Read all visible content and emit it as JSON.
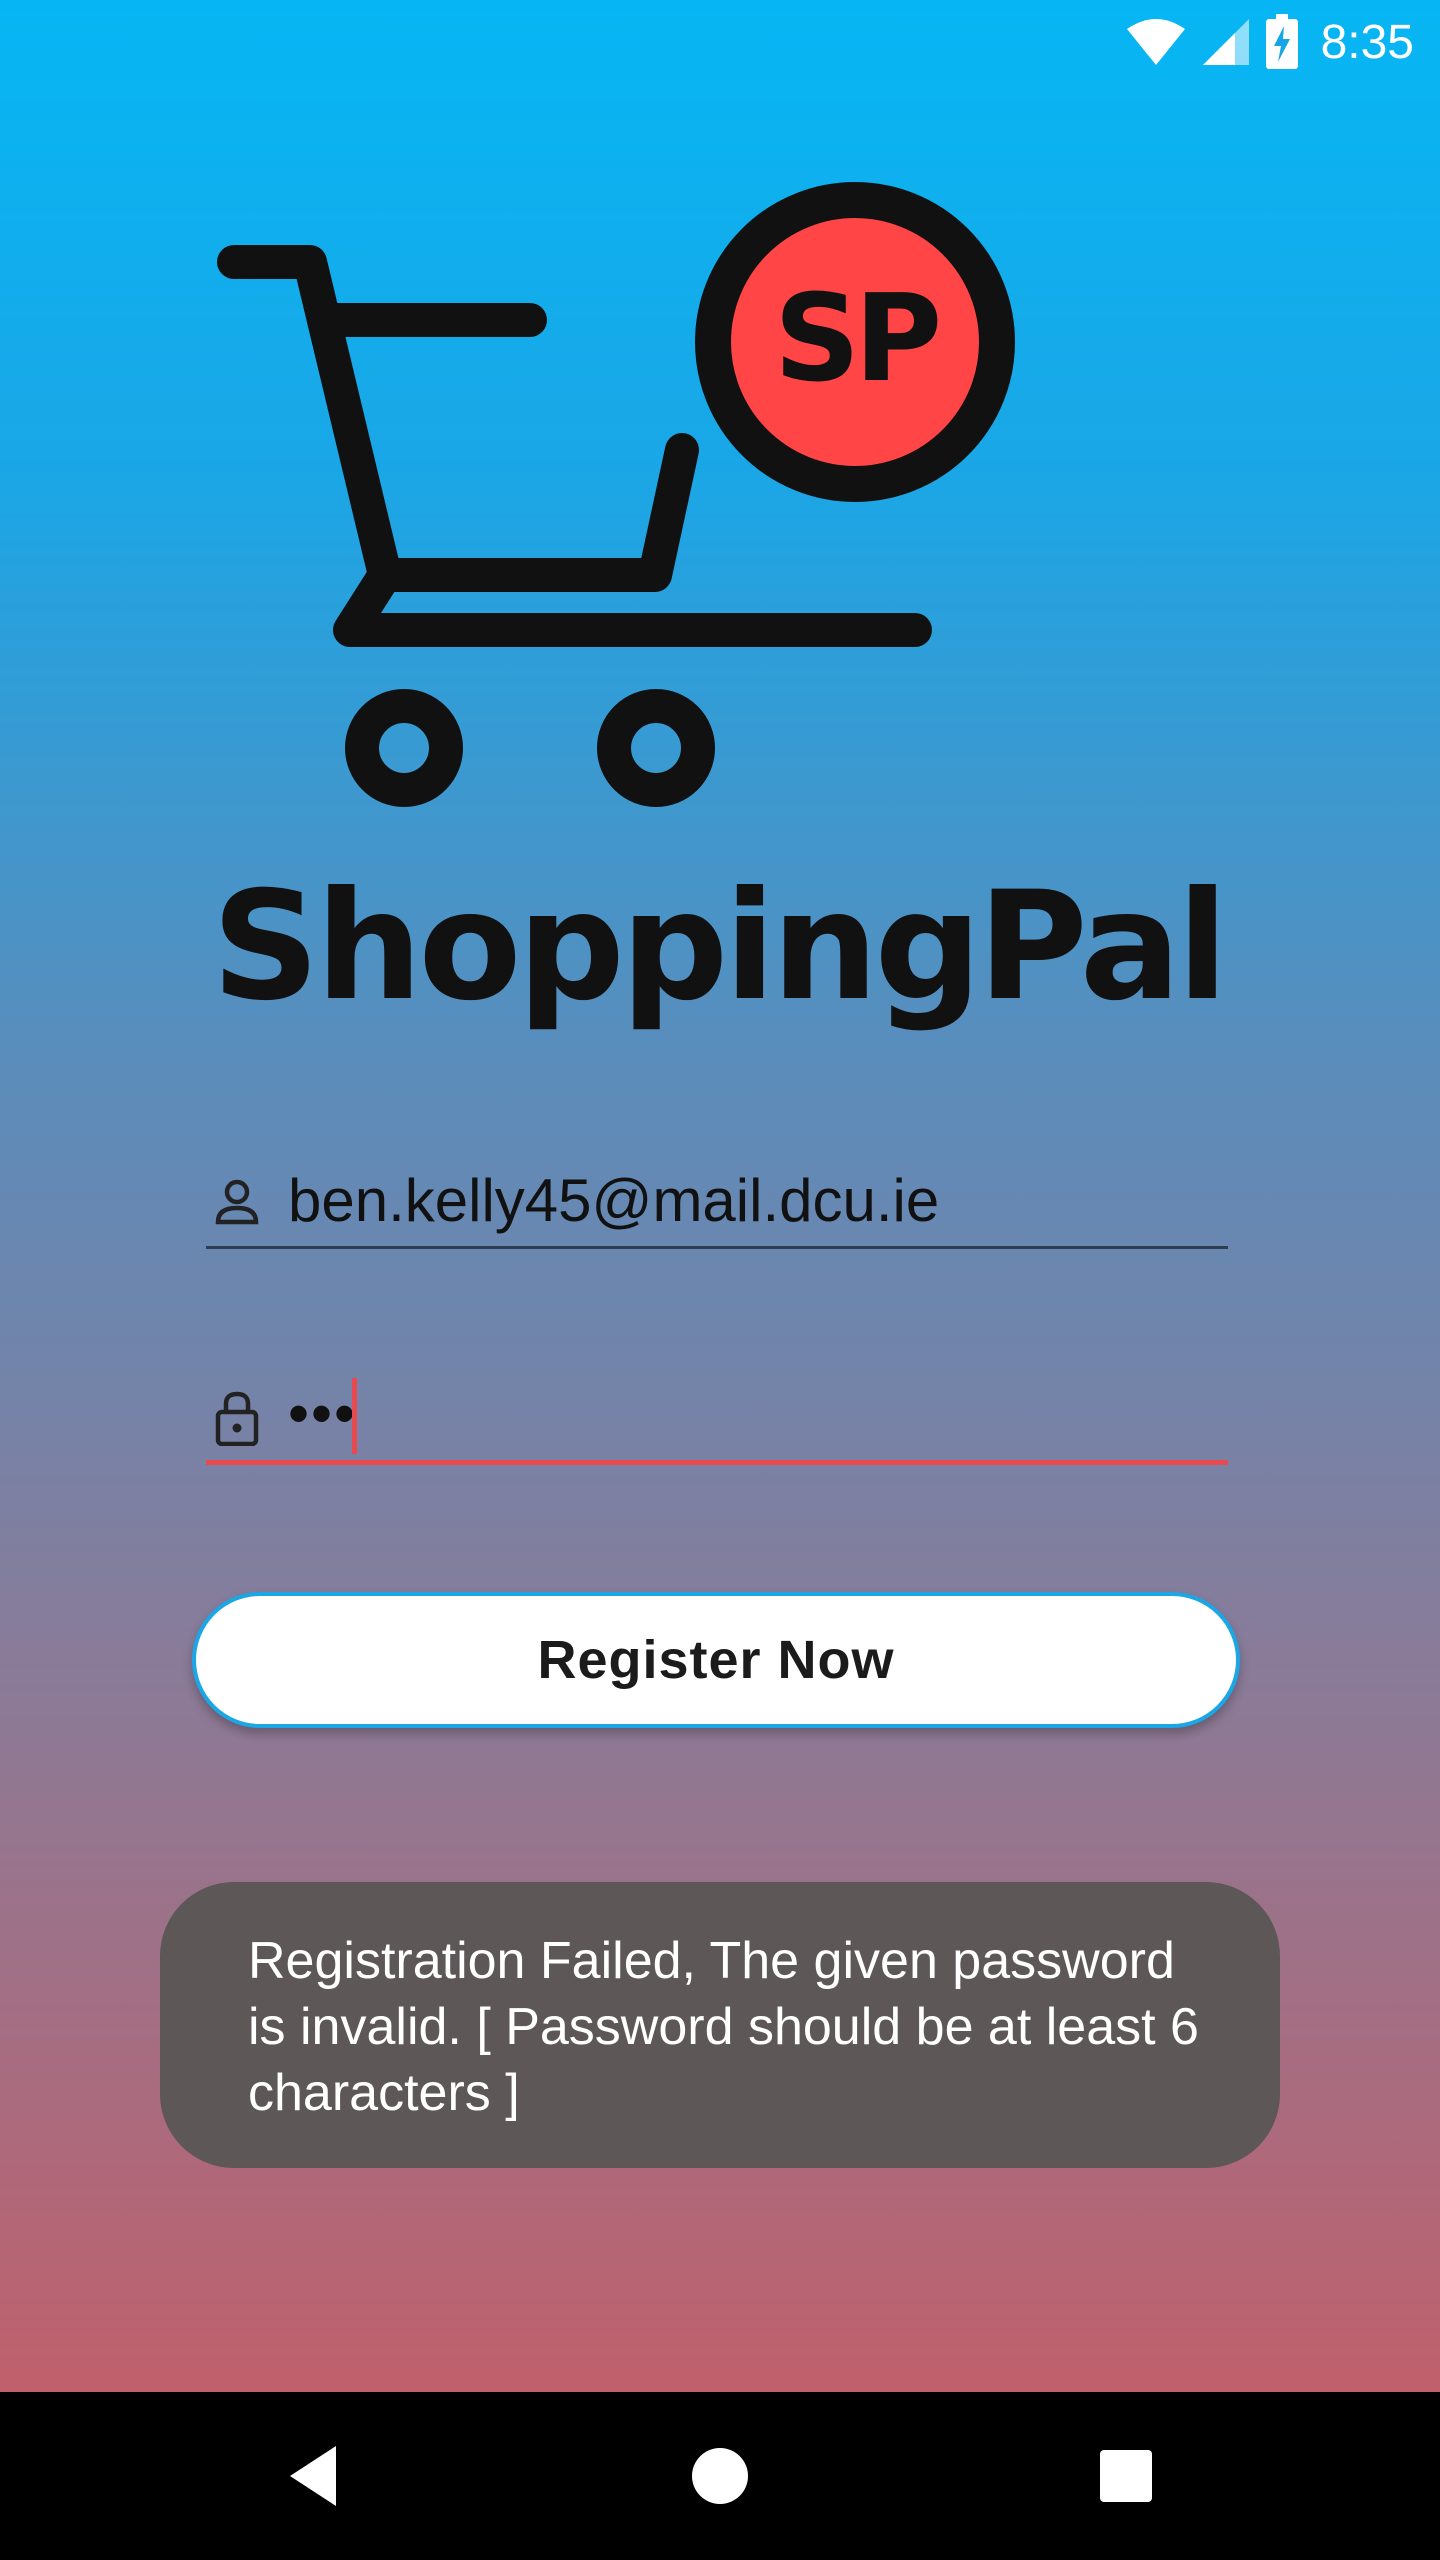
{
  "status_bar": {
    "time": "8:35",
    "icons": [
      "wifi-icon",
      "signal-icon",
      "battery-charging-icon"
    ]
  },
  "logo": {
    "badge_text": "SP",
    "app_name": "ShoppingPal",
    "badge_color": "#ff4545"
  },
  "form": {
    "email_value": "ben.kelly45@mail.dcu.ie",
    "password_masked": "•••",
    "email_icon": "person-icon",
    "password_icon": "lock-icon",
    "error_color": "#e84a4f"
  },
  "register_button": {
    "label": "Register Now"
  },
  "toast": {
    "message": "Registration Failed, The given password is invalid. [ Password should be at least 6 characters ]"
  },
  "nav_bar": {
    "icons": [
      "back-icon",
      "home-icon",
      "recents-icon"
    ]
  }
}
